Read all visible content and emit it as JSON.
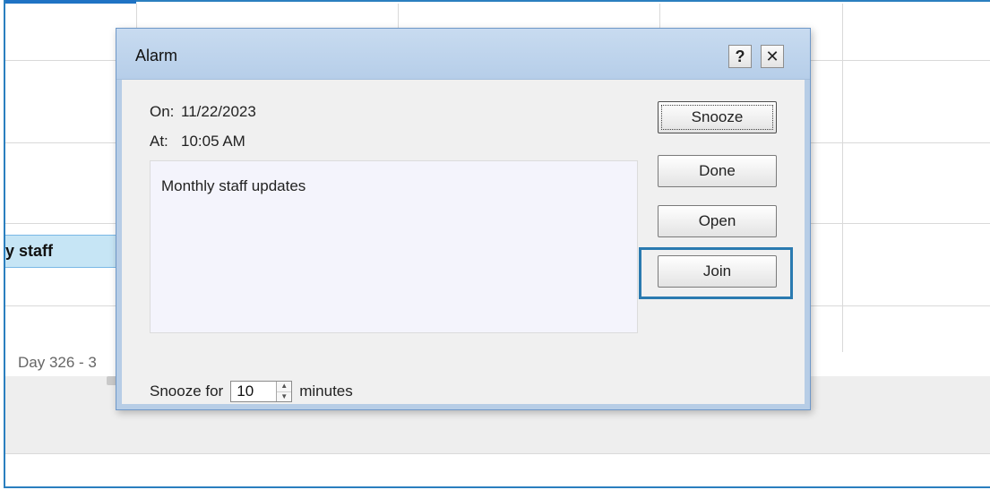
{
  "background": {
    "event_label": "y staff",
    "day_label": "Day 326 - 3"
  },
  "dialog": {
    "title": "Alarm",
    "help_glyph": "?",
    "close_glyph": "✕",
    "on_label": "On:",
    "on_value": "11/22/2023",
    "at_label": "At:",
    "at_value": "10:05 AM",
    "message": "Monthly staff updates",
    "buttons": {
      "snooze": "Snooze",
      "done": "Done",
      "open": "Open",
      "join": "Join"
    },
    "snooze_row": {
      "label": "Snooze for",
      "value": "10",
      "unit": "minutes"
    }
  },
  "icons": {
    "help": "help-icon",
    "close": "close-icon",
    "spinner_up": "chevron-up-icon",
    "spinner_down": "chevron-down-icon"
  },
  "colors": {
    "accent": "#2a7ab0",
    "titlebar": "#c8dbf0",
    "event": "#c6e5f5"
  }
}
